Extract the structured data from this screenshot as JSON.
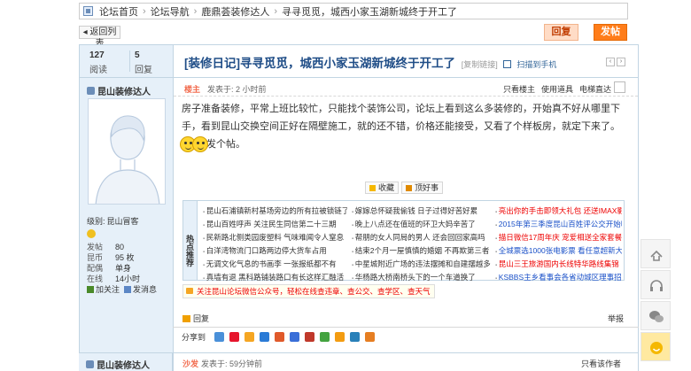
{
  "breadcrumb": {
    "items": [
      "论坛首页",
      "论坛导航",
      "鹿鼎荟装修达人",
      "寻寻觅觅，城西小家玉湖新城终于开工了"
    ]
  },
  "toolbar": {
    "back_label": "◂ 返回列表",
    "reply_label": "回复",
    "post_label": "发帖"
  },
  "stats": {
    "views": "127",
    "views_label": "阅读",
    "replies": "5",
    "replies_label": "回复"
  },
  "thread": {
    "title": "[装修日记]寻寻觅觅，城西小家玉湖新城终于开工了",
    "copy_link": "[复制链接]",
    "mobile": "扫描到手机",
    "pager_prev": "‹",
    "pager_next": "›"
  },
  "post": {
    "floor": "楼主",
    "time": "发表于: 2 小时前",
    "options": [
      "只看楼主",
      "使用道具",
      "电梯直达"
    ],
    "body_main": "房子准备装修，平常上班比较忙，只能找个装饰公司，论坛上看到这么多装修的，开始真不好从哪里下手，看到昆山交换空间正好在隔壁施工，就的还不错，价格还能接受，又看了个样板房，就定下来了。",
    "body_tail": "发个帖。",
    "collect_label": "收藏",
    "like_label": "顶好事",
    "reply_label": "回复",
    "report_label": "举报"
  },
  "author": {
    "name": "昆山装修达人",
    "level_label": "级别:",
    "level": "昆山冒客",
    "rows": [
      {
        "k": "发帖",
        "v": "80"
      },
      {
        "k": "昆币",
        "v": "95 枚"
      },
      {
        "k": "配偶",
        "v": "单身"
      },
      {
        "k": "在线",
        "v": "14小时"
      }
    ],
    "follow": "加关注",
    "message": "发消息"
  },
  "recommend": {
    "label": "热点推荐",
    "col1": [
      "昆山石浦镇新村基场旁边的所有拉被锁链了",
      "昆山百姓呼声 关注民生同信第二十三期",
      "民新路北侧类园废塑料 气味难闻令人窒息",
      "白洋湾物流门口路两边停大货车占用",
      "无调文化气息的书画李 一张报纸都不有",
      "真墙有退 黑科路铺装路口有长这样汇融活"
    ],
    "col2": [
      "嫁嫁总怀疑我偷钱 日子过得好苦好累",
      "晚上八点还在值班的环卫大妈辛苦了",
      "帮朋的女人同局的男人 还会回回家高吗",
      "结束2个月一屋慎慎的婚姻 不再欺第三者",
      "中星城附近广场的违法摆摊和自建摆越多了",
      "华杨路大桥南桥头下的一个车道换了"
    ],
    "col3": [
      "亮出你的手击即领大礼包 还送IMAX影票",
      "2015年第三季度昆山百姓评公交开始啦",
      "描日微信17周年庆 宠爱相送全家套餐",
      "全城票选1000张电影票 看任意超新大片",
      "昆山三王旅游国内长线特华路线集锦",
      "KSBBS主乡看事会各省动城区理事招募中"
    ]
  },
  "wechat_bar": "关注昆山论坛微信公众号，轻松在线查违章、查公交、查学区、查天气",
  "share": {
    "label": "分享到"
  },
  "next_post": {
    "author": "昆山装修达人",
    "floor": "沙发",
    "time": "发表于: 59分钟前",
    "only": "只看该作者"
  },
  "colors": {
    "accent_blue": "#1f4d87",
    "orange_button": "#ff7d1a",
    "panel_blue": "#e6f0f9",
    "border_blue": "#c2d5e3"
  }
}
